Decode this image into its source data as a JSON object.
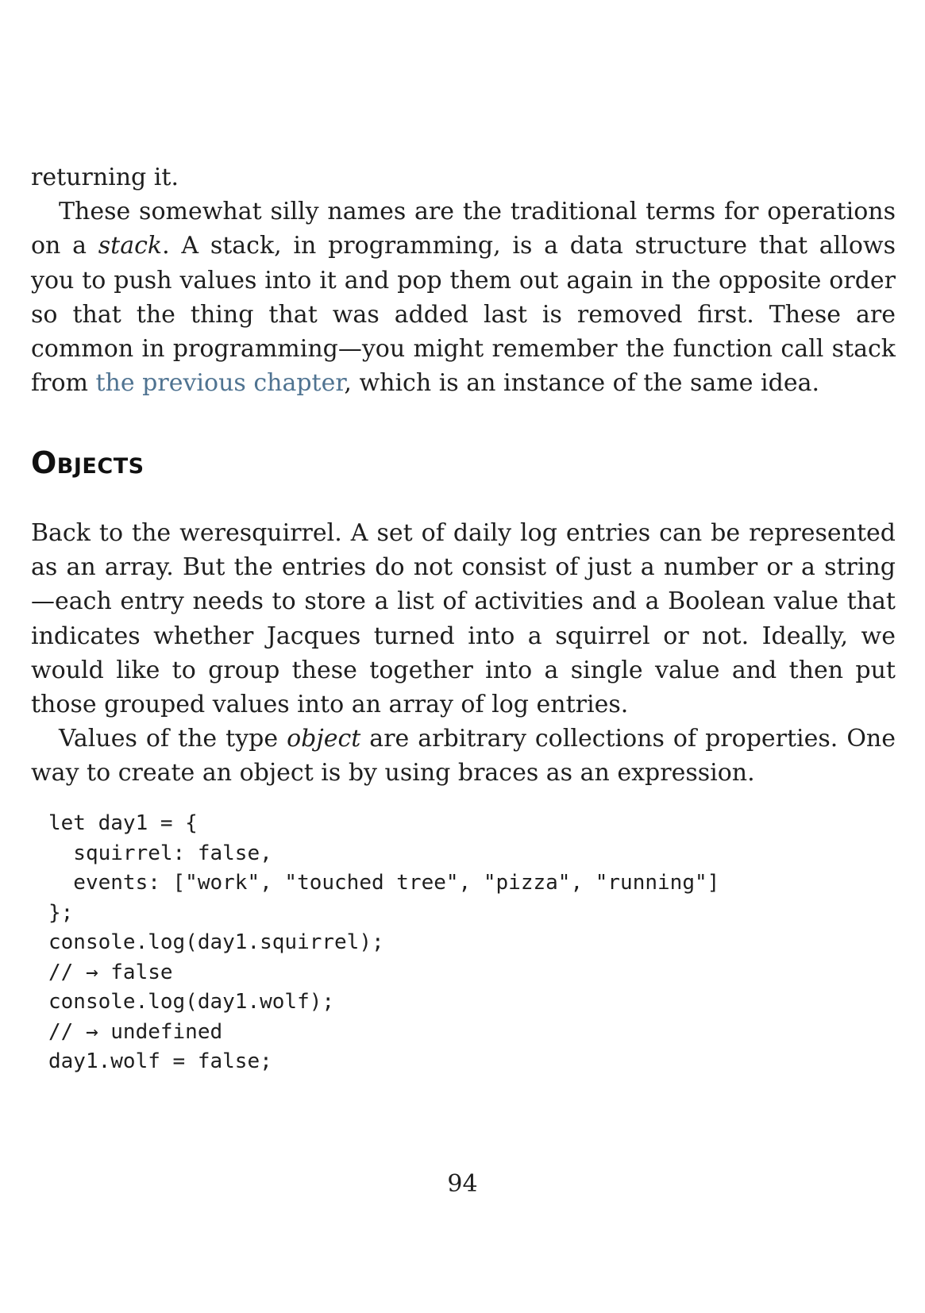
{
  "paragraphs_top": {
    "p1": "returning it.",
    "p2_a": "These somewhat silly names are the traditional terms for operations on a ",
    "p2_em": "stack",
    "p2_b": ". A stack, in programming, is a data structure that allows you to push values into it and pop them out again in the opposite order so that the thing that was added last is removed first. These are common in programming—you might remember the function call stack from ",
    "p2_link": "the previous chapter",
    "p2_c": ", which is an instance of the same idea."
  },
  "section": {
    "heading": "Objects"
  },
  "paragraphs_section": {
    "p1": "Back to the weresquirrel. A set of daily log entries can be represented as an array. But the entries do not consist of just a number or a string—each entry needs to store a list of activities and a Boolean value that indicates whether Jacques turned into a squirrel or not. Ideally, we would like to group these together into a single value and then put those grouped values into an array of log entries.",
    "p2_a": "Values of the type ",
    "p2_em": "object",
    "p2_b": " are arbitrary collections of properties. One way to create an object is by using braces as an expression."
  },
  "code_lines": [
    "let day1 = {",
    "  squirrel: false,",
    "  events: [\"work\", \"touched tree\", \"pizza\", \"running\"]",
    "};",
    "console.log(day1.squirrel);",
    "// → false",
    "console.log(day1.wolf);",
    "// → undefined",
    "day1.wolf = false;"
  ],
  "page_number": "94",
  "colors": {
    "text": "#1e1e1e",
    "link": "#4f7391",
    "background": "#ffffff"
  }
}
